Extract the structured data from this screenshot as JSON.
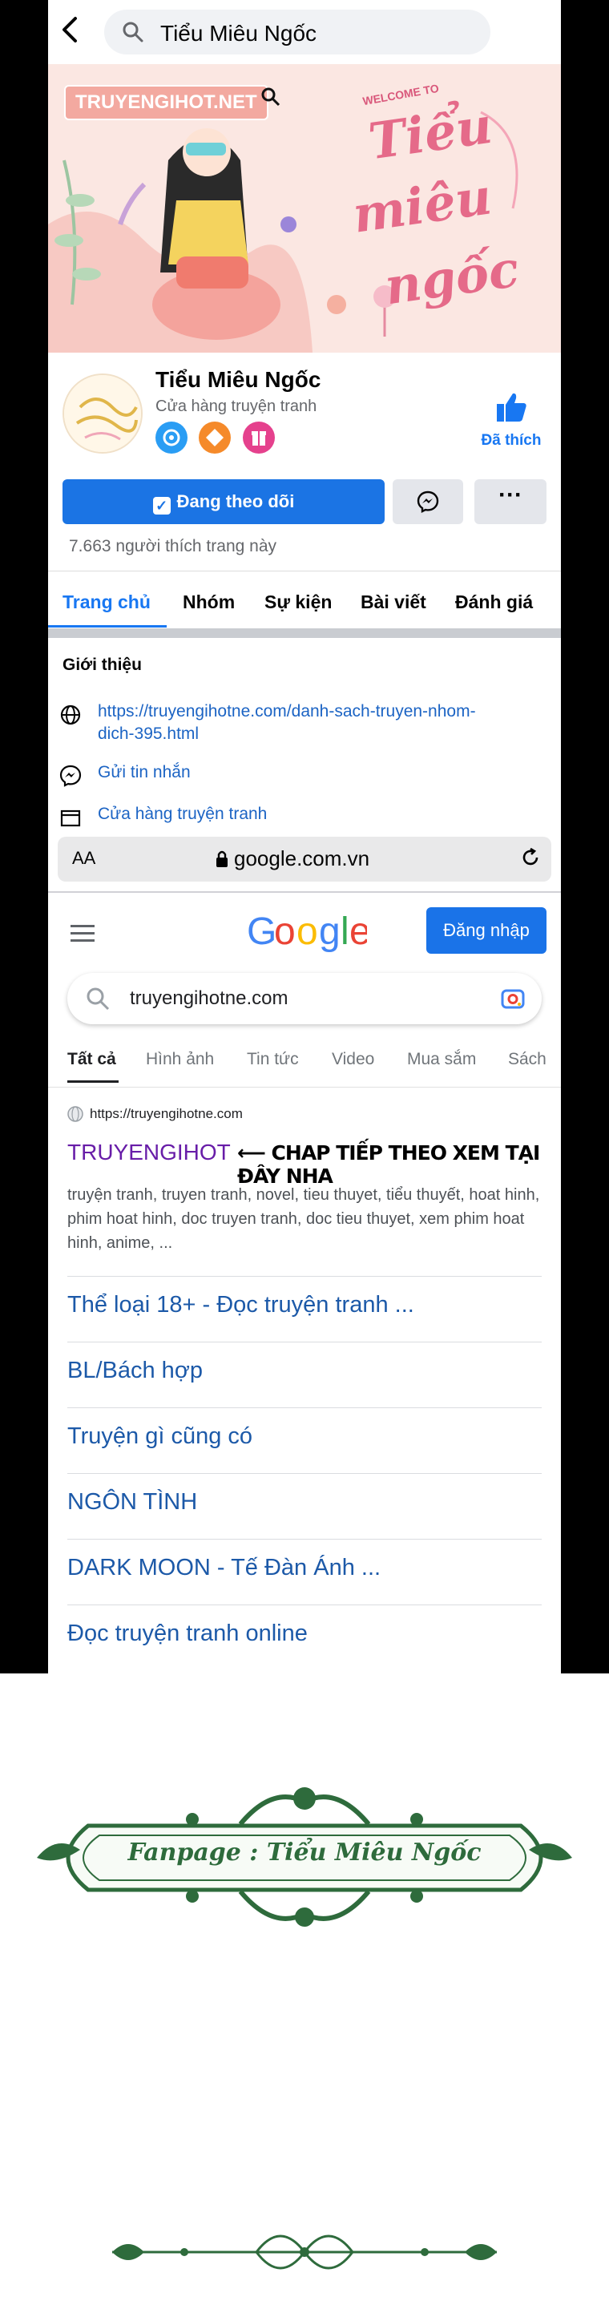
{
  "search": {
    "query": "Tiểu Miêu Ngốc"
  },
  "cover": {
    "watermark": "TRUYENGIHOT.NET",
    "welcome": "WELCOME TO",
    "script_lines": [
      "Tiểu",
      "miêu",
      "ngốc"
    ]
  },
  "page": {
    "name": "Tiểu Miêu Ngốc",
    "category": "Cửa hàng truyện tranh",
    "liked_label": "Đã thích",
    "follow_label": "Đang theo dõi",
    "more_label": "···",
    "likes_text": "7.663 người thích trang này"
  },
  "tabs": [
    "Trang chủ",
    "Nhóm",
    "Sự kiện",
    "Bài viết",
    "Đánh giá"
  ],
  "intro": {
    "heading": "Giới thiệu",
    "link_line1": "https://truyengihotne.com/danh-sach-truyen-nhom-",
    "link_line2": "dich-395.html",
    "message": "Gửi tin nhắn",
    "shop": "Cửa hàng truyện tranh"
  },
  "browser": {
    "aa": "AA",
    "domain": "google.com.vn"
  },
  "google": {
    "signin": "Đăng nhập",
    "query": "truyengihotne.com",
    "tabs": [
      "Tất cả",
      "Hình ảnh",
      "Tin tức",
      "Video",
      "Mua sắm",
      "Sách"
    ],
    "result": {
      "url": "https://truyengihotne.com",
      "title": "TRUYENGIHOT",
      "note": "⟵ CHAP TIẾP THEO XEM TẠI ĐÂY NHA",
      "snippet": "truyện tranh, truyen tranh, novel, tieu thuyet, tiểu thuyết, hoat hinh, phim hoat hinh, doc truyen tranh, doc tieu thuyet, xem phim hoat hinh, anime, ..."
    },
    "sitelinks": [
      "Thể loại 18+ - Đọc truyện tranh ...",
      "BL/Bách hợp",
      "Truyện gì cũng có",
      "NGÔN TÌNH",
      "DARK MOON - Tế Đàn Ánh ...",
      "Đọc truyện tranh online"
    ]
  },
  "footer": {
    "banner_text": "Fanpage : Tiểu Miêu Ngốc"
  },
  "colors": {
    "facebook_blue": "#1877f2",
    "google_blue": "#1a73e8",
    "visited_purple": "#681da8",
    "ornament_green": "#2e6b3c"
  }
}
